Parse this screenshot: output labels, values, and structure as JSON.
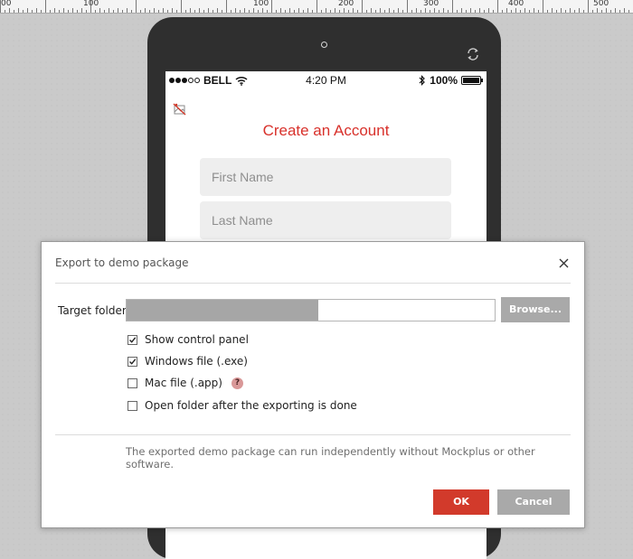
{
  "ruler": {
    "labels": [
      "00",
      "100",
      "100",
      "200",
      "300",
      "400",
      "500"
    ]
  },
  "phone": {
    "status_bar": {
      "carrier": "BELL",
      "time": "4:20 PM",
      "battery": "100%",
      "battery_level": 1.0,
      "signal_bars_filled": 3,
      "signal_bars_total": 5
    },
    "screen_title": "Create an Account",
    "fields": [
      {
        "placeholder": "First Name"
      },
      {
        "placeholder": "Last Name"
      }
    ],
    "icons": [
      "rotate-icon",
      "broken-image-icon",
      "wifi-icon",
      "bluetooth-icon"
    ]
  },
  "dialog": {
    "title": "Export to demo package",
    "target_folder_label": "Target folder",
    "target_folder_fill": 0.52,
    "browse_label": "Browse...",
    "options": [
      {
        "label": "Show control panel",
        "checked": true
      },
      {
        "label": "Windows file (.exe)",
        "checked": true
      },
      {
        "label": "Mac file (.app)",
        "checked": false,
        "help": "?"
      },
      {
        "label": "Open folder after the exporting is done",
        "checked": false
      }
    ],
    "note": "The exported demo package can run independently without Mockplus or other software.",
    "ok_label": "OK",
    "cancel_label": "Cancel",
    "accent_color": "#d23a2b",
    "title_color": "#d8312b"
  }
}
